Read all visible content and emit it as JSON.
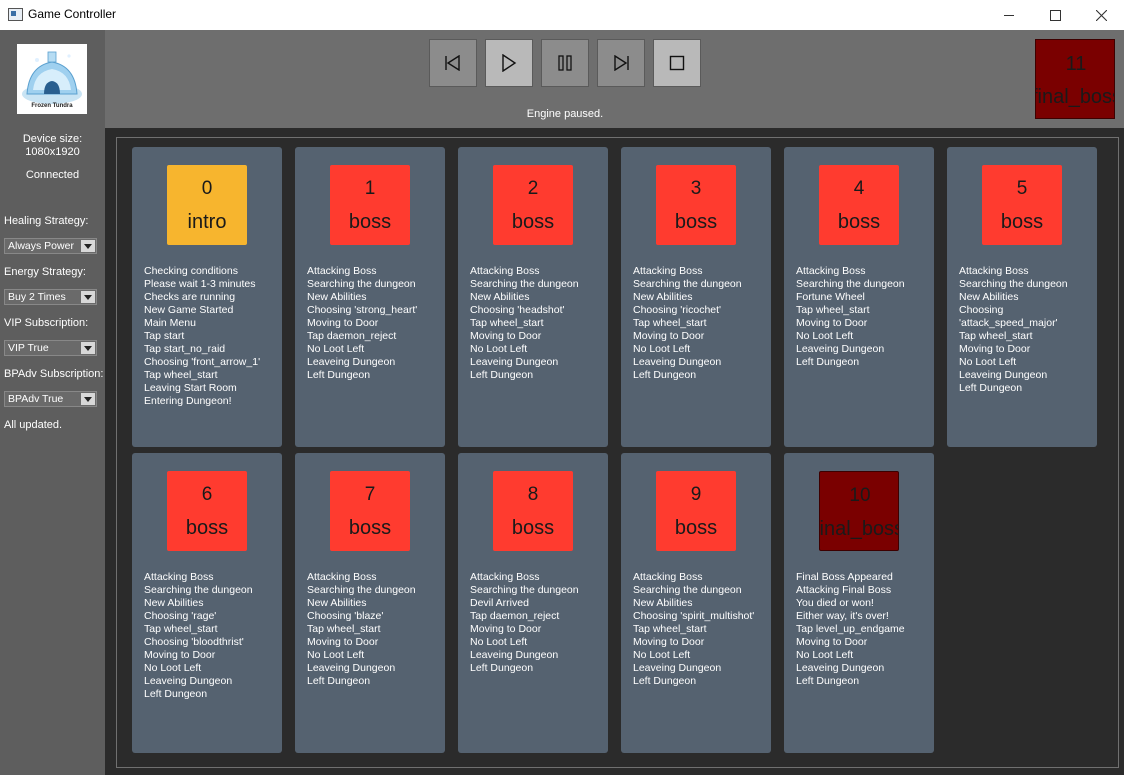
{
  "window": {
    "title": "Game Controller"
  },
  "sidebar": {
    "logo_text": "Frozen Tundra",
    "device_size_label": "Device size:",
    "device_size_value": "1080x1920",
    "connection_status": "Connected",
    "healing": {
      "label": "Healing Strategy:",
      "value": "Always Power"
    },
    "energy": {
      "label": "Energy Strategy:",
      "value": "Buy 2 Times"
    },
    "vip": {
      "label": "VIP Subscription:",
      "value": "VIP True"
    },
    "bpadv": {
      "label": "BPAdv Subscription:",
      "value": "BPAdv True"
    },
    "update_status": "All updated."
  },
  "controls": {
    "icons": [
      "skip-previous-icon",
      "play-icon",
      "pause-icon",
      "skip-next-icon",
      "stop-icon"
    ],
    "status": "Engine paused.",
    "current_level": {
      "number": "11",
      "name": "final_boss"
    }
  },
  "levels": [
    {
      "number": "0",
      "name": "intro",
      "color": "#f7b52e",
      "log": [
        "Checking conditions",
        "Please wait 1-3 minutes",
        "Checks are running",
        "New Game Started",
        "Main Menu",
        "Tap start",
        "Tap start_no_raid",
        "Choosing 'front_arrow_1'",
        "Tap wheel_start",
        "Leaving Start Room",
        "Entering Dungeon!"
      ]
    },
    {
      "number": "1",
      "name": "boss",
      "color": "#ff3b2f",
      "log": [
        "Attacking Boss",
        "Searching the dungeon",
        "New Abilities",
        "Choosing 'strong_heart'",
        "Moving to Door",
        "Tap daemon_reject",
        "No Loot Left",
        "Leaveing Dungeon",
        "Left Dungeon"
      ]
    },
    {
      "number": "2",
      "name": "boss",
      "color": "#ff3b2f",
      "log": [
        "Attacking Boss",
        "Searching the dungeon",
        "New Abilities",
        "Choosing 'headshot'",
        "Tap wheel_start",
        "Moving to Door",
        "No Loot Left",
        "Leaveing Dungeon",
        "Left Dungeon"
      ]
    },
    {
      "number": "3",
      "name": "boss",
      "color": "#ff3b2f",
      "log": [
        "Attacking Boss",
        "Searching the dungeon",
        "New Abilities",
        "Choosing 'ricochet'",
        "Tap wheel_start",
        "Moving to Door",
        "No Loot Left",
        "Leaveing Dungeon",
        "Left Dungeon"
      ]
    },
    {
      "number": "4",
      "name": "boss",
      "color": "#ff3b2f",
      "log": [
        "Attacking Boss",
        "Searching the dungeon",
        "Fortune Wheel",
        "Tap wheel_start",
        "Moving to Door",
        "No Loot Left",
        "Leaveing Dungeon",
        "Left Dungeon"
      ]
    },
    {
      "number": "5",
      "name": "boss",
      "color": "#ff3b2f",
      "log": [
        "Attacking Boss",
        "Searching the dungeon",
        "New Abilities",
        "Choosing",
        "'attack_speed_major'",
        "Tap wheel_start",
        "Moving to Door",
        "No Loot Left",
        "Leaveing Dungeon",
        "Left Dungeon"
      ]
    },
    {
      "number": "6",
      "name": "boss",
      "color": "#ff3b2f",
      "log": [
        "Attacking Boss",
        "Searching the dungeon",
        "New Abilities",
        "Choosing 'rage'",
        "Tap wheel_start",
        "Choosing 'bloodthrist'",
        "Moving to Door",
        "No Loot Left",
        "Leaveing Dungeon",
        "Left Dungeon"
      ]
    },
    {
      "number": "7",
      "name": "boss",
      "color": "#ff3b2f",
      "log": [
        "Attacking Boss",
        "Searching the dungeon",
        "New Abilities",
        "Choosing 'blaze'",
        "Tap wheel_start",
        "Moving to Door",
        "No Loot Left",
        "Leaveing Dungeon",
        "Left Dungeon"
      ]
    },
    {
      "number": "8",
      "name": "boss",
      "color": "#ff3b2f",
      "log": [
        "Attacking Boss",
        "Searching the dungeon",
        "Devil Arrived",
        "Tap daemon_reject",
        "Moving to Door",
        "No Loot Left",
        "Leaveing Dungeon",
        "Left Dungeon"
      ]
    },
    {
      "number": "9",
      "name": "boss",
      "color": "#ff3b2f",
      "log": [
        "Attacking Boss",
        "Searching the dungeon",
        "New Abilities",
        "Choosing 'spirit_multishot'",
        "Tap wheel_start",
        "Moving to Door",
        "No Loot Left",
        "Leaveing Dungeon",
        "Left Dungeon"
      ]
    },
    {
      "number": "10",
      "name": "final_boss",
      "color": "#7a0000",
      "log": [
        "Final Boss Appeared",
        "Attacking Final Boss",
        "You died or won!",
        "Either way, it's over!",
        "Tap level_up_endgame",
        "Moving to Door",
        "No Loot Left",
        "Leaveing Dungeon",
        "Left Dungeon"
      ]
    }
  ]
}
